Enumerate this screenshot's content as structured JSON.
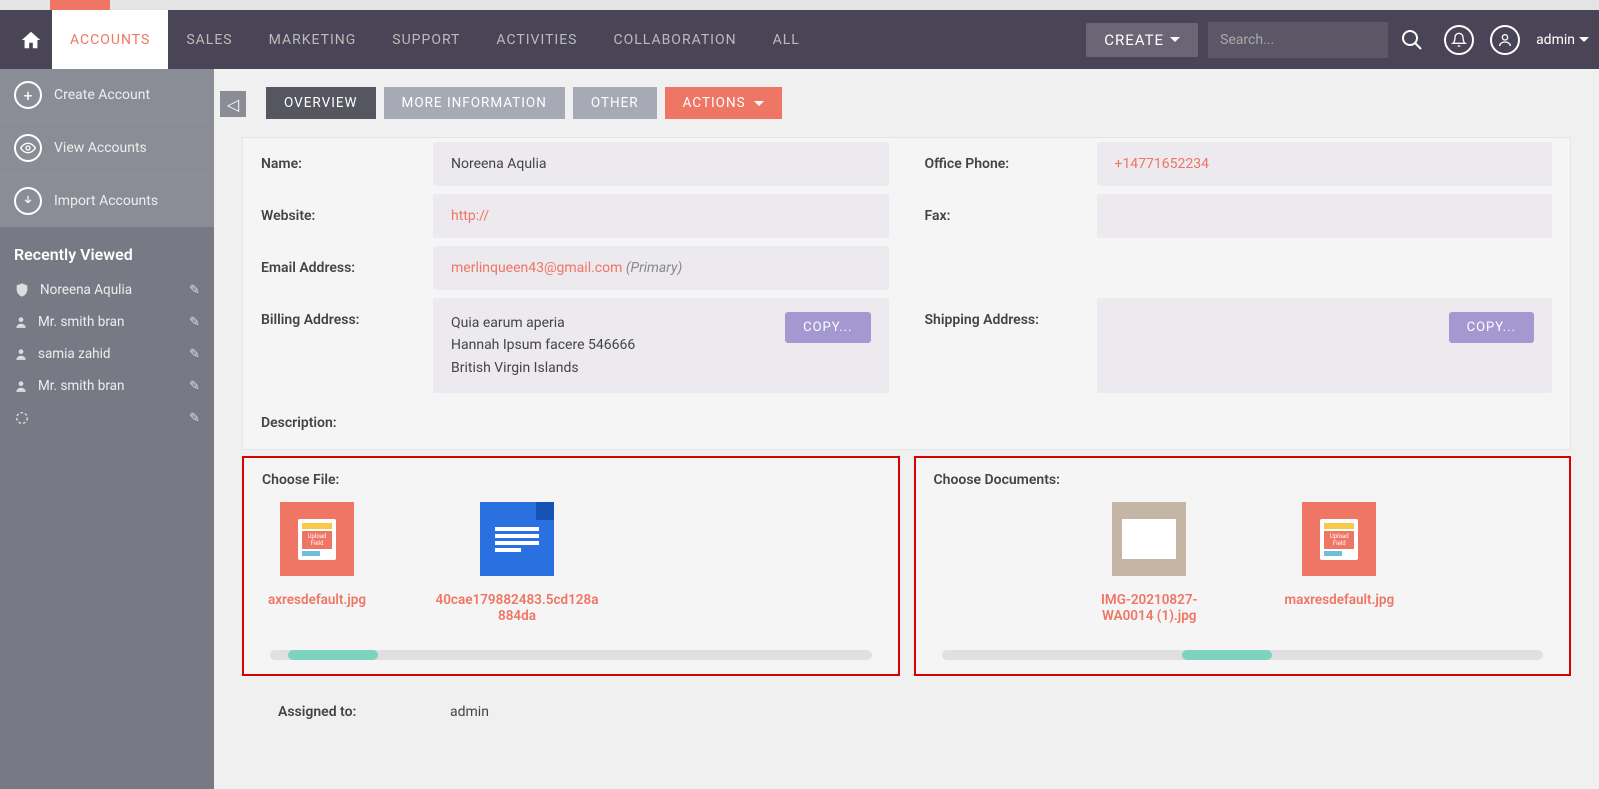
{
  "nav": {
    "items": [
      "ACCOUNTS",
      "SALES",
      "MARKETING",
      "SUPPORT",
      "ACTIVITIES",
      "COLLABORATION",
      "ALL"
    ],
    "create_label": "CREATE",
    "search_placeholder": "Search...",
    "admin_label": "admin"
  },
  "sidebar": {
    "actions": [
      {
        "label": "Create Account"
      },
      {
        "label": "View Accounts"
      },
      {
        "label": "Import Accounts"
      }
    ],
    "recent_header": "Recently Viewed",
    "recent": [
      {
        "name": "Noreena Aqulia",
        "icon": "shield"
      },
      {
        "name": "Mr. smith bran",
        "icon": "person"
      },
      {
        "name": "samia zahid",
        "icon": "person"
      },
      {
        "name": "Mr. smith bran",
        "icon": "person"
      },
      {
        "name": "",
        "icon": "loading"
      }
    ]
  },
  "tabs": {
    "overview": "OVERVIEW",
    "more": "MORE INFORMATION",
    "other": "OTHER",
    "actions": "ACTIONS"
  },
  "details": {
    "name_label": "Name:",
    "name_value": "Noreena Aqulia",
    "website_label": "Website:",
    "website_value": "http://",
    "email_label": "Email Address:",
    "email_value": "merlinqueen43@gmail.com",
    "email_primary": "(Primary)",
    "billing_label": "Billing Address:",
    "billing_line1": "Quia earum aperia",
    "billing_line2": "Hannah Ipsum facere   546666",
    "billing_line3": "British Virgin Islands",
    "copy_label": "COPY...",
    "description_label": "Description:",
    "office_phone_label": "Office Phone:",
    "office_phone_value": "+14771652234",
    "fax_label": "Fax:",
    "fax_value": "",
    "shipping_label": "Shipping Address:",
    "assigned_label": "Assigned to:",
    "assigned_value": "admin"
  },
  "file_section": {
    "choose_file_label": "Choose File:",
    "choose_docs_label": "Choose Documents:",
    "files": [
      {
        "name": "axresdefault.jpg",
        "thumb": "upload"
      },
      {
        "name": "40cae179882483.5cd128a884da",
        "thumb": "doc"
      }
    ],
    "docs": [
      {
        "name": "IMG-20210827-WA0014 (1).jpg",
        "thumb": "photo"
      },
      {
        "name": "maxresdefault.jpg",
        "thumb": "upload"
      }
    ]
  }
}
